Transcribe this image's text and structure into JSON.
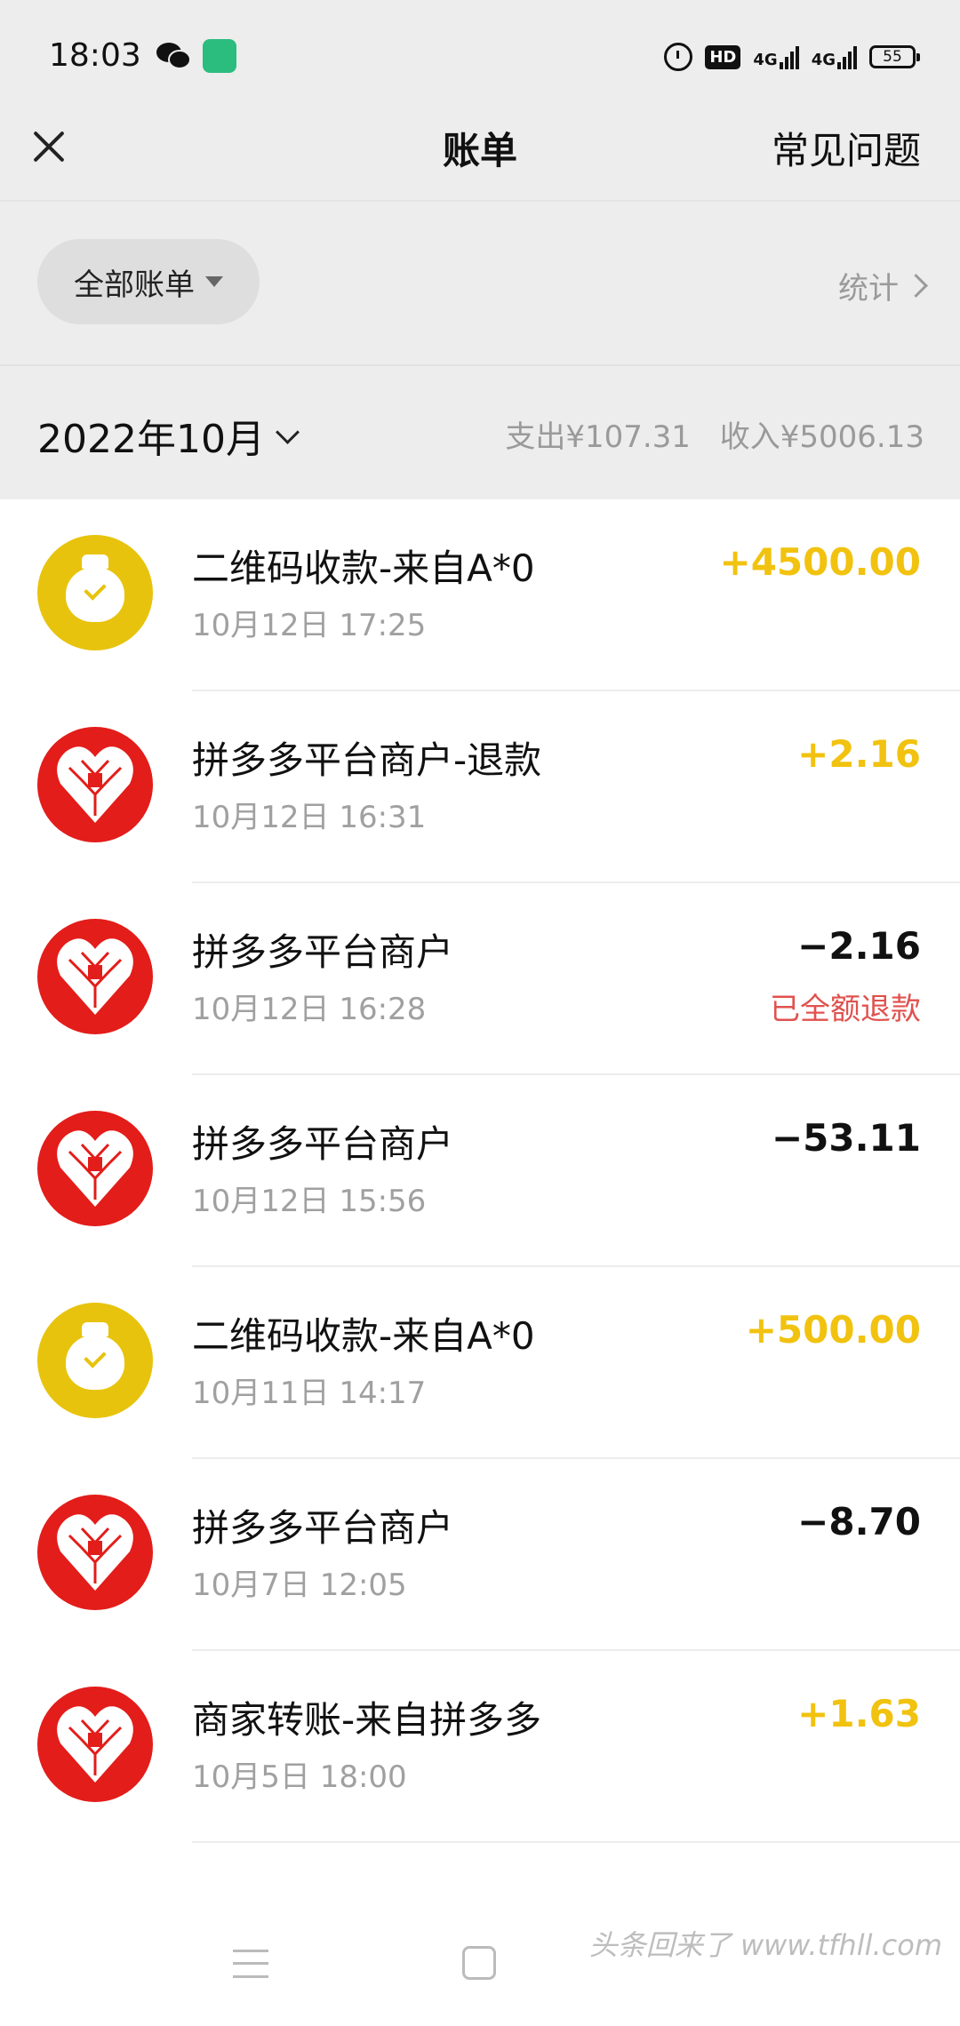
{
  "status_bar": {
    "time": "18:03",
    "hd_label": "HD",
    "net1": "4G",
    "net2": "4G",
    "battery": "55"
  },
  "nav": {
    "title": "账单",
    "faq": "常见问题"
  },
  "filter": {
    "label": "全部账单",
    "stats": "统计"
  },
  "month": {
    "label": "2022年10月",
    "expense": "支出¥107.31",
    "income": "收入¥5006.13"
  },
  "transactions": [
    {
      "title": "二维码收款-来自A*0",
      "time": "10月12日 17:25",
      "amount": "+4500.00",
      "type": "income",
      "avatar": "money-bag"
    },
    {
      "title": "拼多多平台商户-退款",
      "time": "10月12日 16:31",
      "amount": "+2.16",
      "type": "income",
      "avatar": "pinduoduo"
    },
    {
      "title": "拼多多平台商户",
      "time": "10月12日 16:28",
      "amount": "−2.16",
      "type": "expense",
      "avatar": "pinduoduo",
      "note": "已全额退款"
    },
    {
      "title": "拼多多平台商户",
      "time": "10月12日 15:56",
      "amount": "−53.11",
      "type": "expense",
      "avatar": "pinduoduo"
    },
    {
      "title": "二维码收款-来自A*0",
      "time": "10月11日 14:17",
      "amount": "+500.00",
      "type": "income",
      "avatar": "money-bag"
    },
    {
      "title": "拼多多平台商户",
      "time": "10月7日 12:05",
      "amount": "−8.70",
      "type": "expense",
      "avatar": "pinduoduo"
    },
    {
      "title": "商家转账-来自拼多多",
      "time": "10月5日 18:00",
      "amount": "+1.63",
      "type": "income",
      "avatar": "pinduoduo"
    }
  ],
  "watermark": "头条回来了 www.tfhll.com",
  "colors": {
    "income": "#f1c20f",
    "expense": "#111111",
    "refund_note": "#e0524f",
    "header_bg": "#ededed",
    "pdd_red": "#e31d1a",
    "gold": "#e8c30d"
  }
}
